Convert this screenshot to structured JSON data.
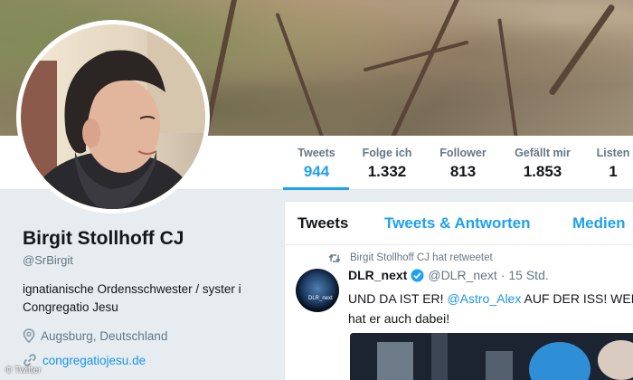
{
  "profile": {
    "name": "Birgit Stollhoff CJ",
    "handle": "@SrBirgit",
    "bio": "ignatianische Ordensschwester / syster i Congregatio Jesu",
    "location": "Augsburg, Deutschland",
    "website": "congregatiojesu.de"
  },
  "stats": [
    {
      "label": "Tweets",
      "value": "944",
      "active": true
    },
    {
      "label": "Folge ich",
      "value": "1.332"
    },
    {
      "label": "Follower",
      "value": "813"
    },
    {
      "label": "Gefällt mir",
      "value": "1.853"
    },
    {
      "label": "Listen",
      "value": "1"
    }
  ],
  "tabs": [
    "Tweets",
    "Tweets & Antworten",
    "Medien"
  ],
  "tweet": {
    "retweet_note": "Birgit Stollhoff CJ hat retweetet",
    "avatar_text": "DLR_next",
    "author": "DLR_next",
    "author_handle": "@DLR_next",
    "time": "· 15 Std.",
    "text_1": "UND DA IST ER! ",
    "mention": "@Astro_Alex",
    "text_2": " AUF DER ISS! WEL",
    "text_3": "hat er auch dabei!"
  },
  "credit": "© Twitter",
  "colors": {
    "accent": "#1da1f2",
    "link": "#1b95e0",
    "muted": "#657786"
  }
}
